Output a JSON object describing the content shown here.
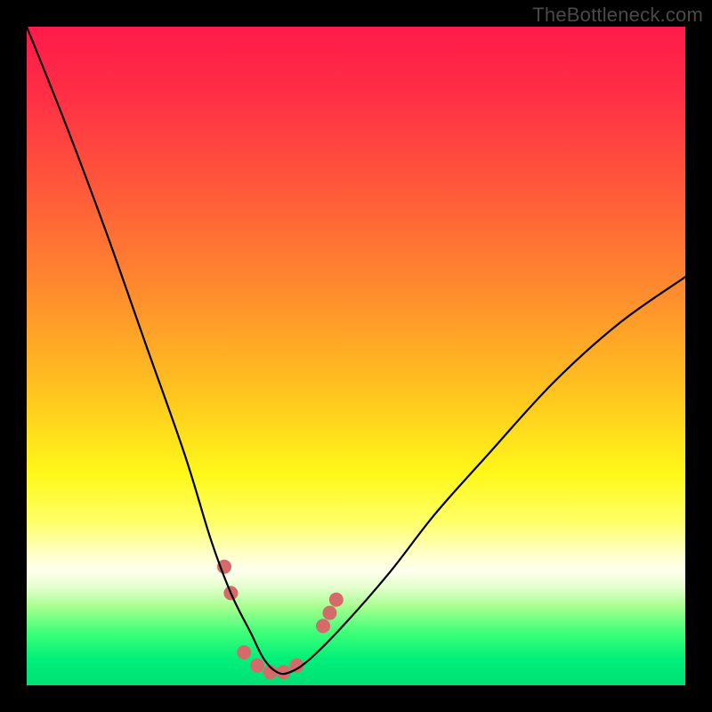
{
  "watermark": "TheBottleneck.com",
  "gradient_stops": [
    {
      "offset": 0.0,
      "color": "#ff1a4a"
    },
    {
      "offset": 0.1,
      "color": "#ff2e46"
    },
    {
      "offset": 0.25,
      "color": "#ff5a39"
    },
    {
      "offset": 0.4,
      "color": "#ff8b2e"
    },
    {
      "offset": 0.55,
      "color": "#ffc21f"
    },
    {
      "offset": 0.68,
      "color": "#fff81a"
    },
    {
      "offset": 0.75,
      "color": "#ffff66"
    },
    {
      "offset": 0.8,
      "color": "#ffffc8"
    },
    {
      "offset": 0.825,
      "color": "#ffffee"
    },
    {
      "offset": 0.85,
      "color": "#e6ffd0"
    },
    {
      "offset": 0.88,
      "color": "#a8ff90"
    },
    {
      "offset": 0.92,
      "color": "#3eff78"
    },
    {
      "offset": 0.96,
      "color": "#00f07a"
    },
    {
      "offset": 1.0,
      "color": "#00e074"
    }
  ],
  "chart_data": {
    "type": "line",
    "title": "",
    "xlabel": "",
    "ylabel": "",
    "xlim": [
      0,
      100
    ],
    "ylim": [
      0,
      100
    ],
    "series": [
      {
        "name": "bottleneck-curve",
        "x": [
          0,
          6,
          12,
          18,
          24,
          28,
          31,
          34,
          36,
          38,
          40,
          43,
          48,
          55,
          62,
          70,
          80,
          90,
          100
        ],
        "y": [
          100,
          85,
          69,
          52,
          35,
          22,
          14,
          8,
          4,
          2,
          2,
          4,
          9,
          17,
          26,
          35,
          46,
          55,
          62
        ]
      }
    ],
    "markers": {
      "color": "#d46a6a",
      "radius_px": 8,
      "points": [
        {
          "x": 30,
          "y": 18
        },
        {
          "x": 31,
          "y": 14
        },
        {
          "x": 33,
          "y": 5
        },
        {
          "x": 35,
          "y": 3
        },
        {
          "x": 37,
          "y": 2
        },
        {
          "x": 39,
          "y": 2
        },
        {
          "x": 41,
          "y": 3
        },
        {
          "x": 45,
          "y": 9
        },
        {
          "x": 46,
          "y": 11
        },
        {
          "x": 47,
          "y": 13
        }
      ]
    }
  }
}
